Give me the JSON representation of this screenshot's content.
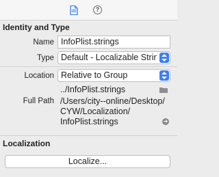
{
  "toolbar": {
    "file_icon": "file-inspector-icon",
    "help_icon": "quick-help-icon",
    "help_glyph": "?",
    "accent": "#3a7ff2"
  },
  "identity": {
    "header": "Identity and Type",
    "name_label": "Name",
    "name_value": "InfoPlist.strings",
    "type_label": "Type",
    "type_value": "Default - Localizable Strings",
    "location_label": "Location",
    "location_value": "Relative to Group",
    "relative_path": "../InfoPlist.strings",
    "fullpath_label": "Full Path",
    "fullpath_line1": "/Users/city--online/Desktop/",
    "fullpath_line2": "CYW/Localization/",
    "fullpath_line3": "InfoPlist.strings"
  },
  "localization": {
    "header": "Localization",
    "button_label": "Localize..."
  }
}
